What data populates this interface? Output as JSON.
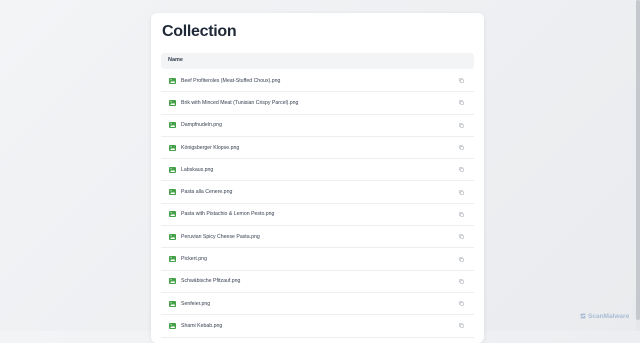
{
  "page": {
    "title": "Collection"
  },
  "table": {
    "header_name": "Name",
    "rows": [
      "Beef Profiteroles (Meat-Stuffed Choux).png",
      "Brik with Minced Meat (Tunisian Crispy Parcel).png",
      "Dampfnudeln.png",
      "Königsberger Klopse.png",
      "Labskaus.png",
      "Pasta alla Cenere.png",
      "Pasta with Pistachio & Lemon Pesto.png",
      "Peruvian Spicy Cheese Pasta.png",
      "Pickert.png",
      "Schwäbische Pfitzauf.png",
      "Senfeier.png",
      "Shami Kebab.png"
    ]
  },
  "icons": {
    "file": "image-icon",
    "action": "copy-icon"
  },
  "colors": {
    "accent_green": "#43a047",
    "title": "#1f2937"
  },
  "watermark": {
    "text": "ScanMalware"
  }
}
